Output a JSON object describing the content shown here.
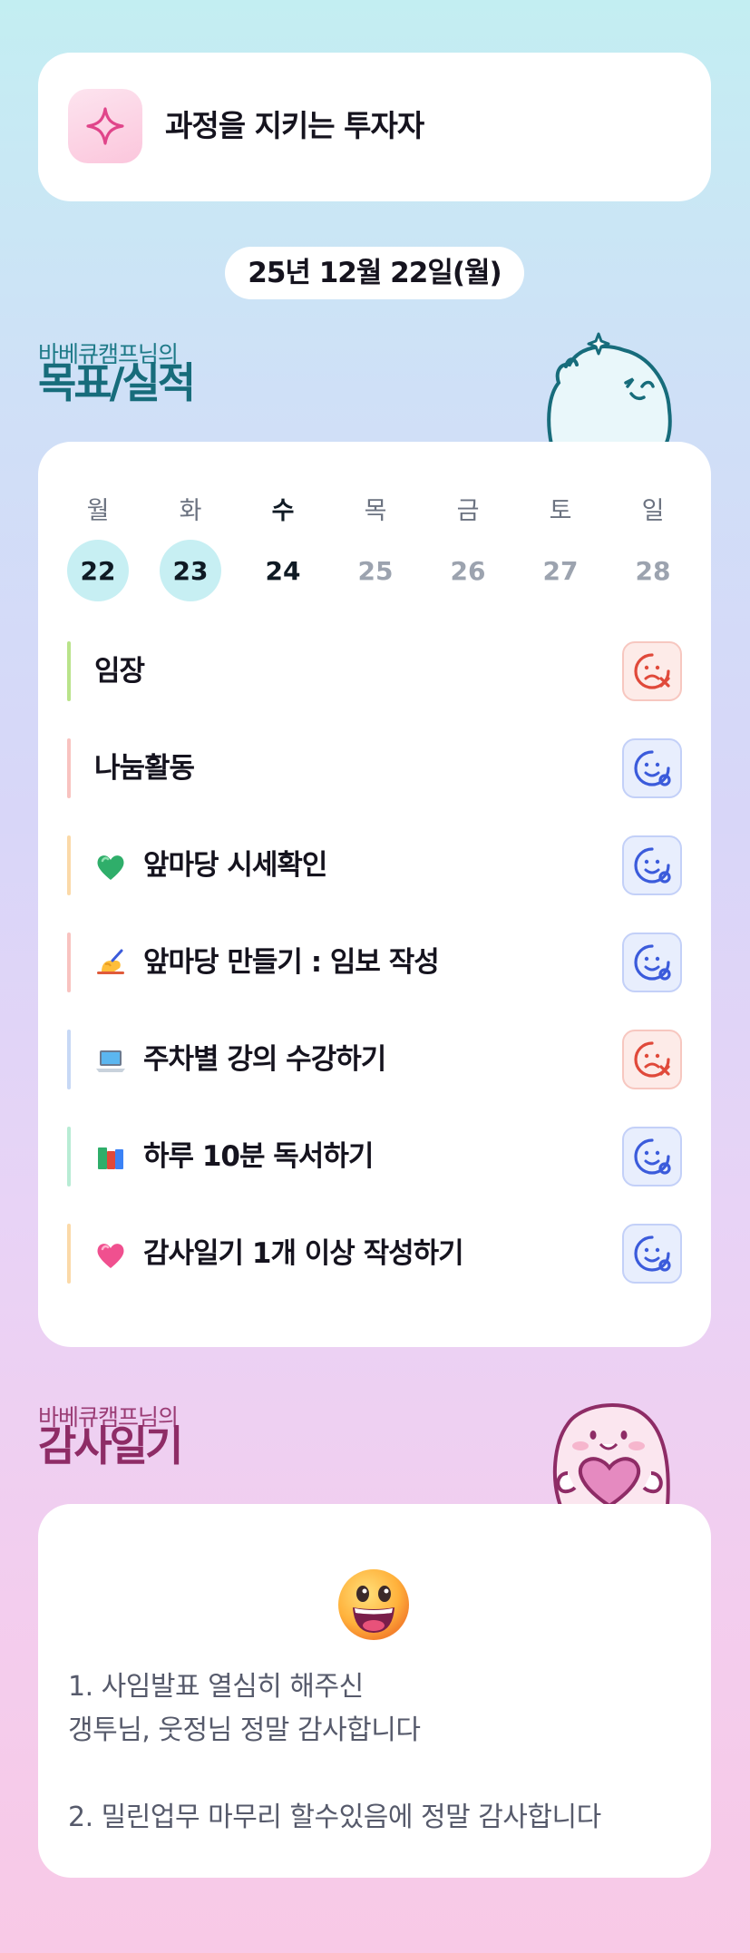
{
  "mission": {
    "title": "과정을 지키는 투자자",
    "icon": "sparkle-icon"
  },
  "date": "25년 12월 22일(월)",
  "goals_section": {
    "owner": "바베큐캠프님의",
    "title": "목표/실적"
  },
  "week": [
    {
      "day": "월",
      "date": "22",
      "state": "done"
    },
    {
      "day": "화",
      "date": "23",
      "state": "done"
    },
    {
      "day": "수",
      "date": "24",
      "state": "today"
    },
    {
      "day": "목",
      "date": "25",
      "state": "future"
    },
    {
      "day": "금",
      "date": "26",
      "state": "future"
    },
    {
      "day": "토",
      "date": "27",
      "state": "future"
    },
    {
      "day": "일",
      "date": "28",
      "state": "future"
    }
  ],
  "goals": [
    {
      "label": "임장",
      "emoji": "",
      "status": "fail",
      "bar_color": "#b9e38a"
    },
    {
      "label": "나눔활동",
      "emoji": "",
      "status": "success",
      "bar_color": "#f8c3c0"
    },
    {
      "label": "앞마당 시세확인",
      "emoji": "green-heart-icon",
      "status": "success",
      "bar_color": "#fbd9a8"
    },
    {
      "label": "앞마당 만들기 : 임보 작성",
      "emoji": "writing-hand-icon",
      "status": "success",
      "bar_color": "#f8c3c0"
    },
    {
      "label": "주차별 강의 수강하기",
      "emoji": "laptop-icon",
      "status": "fail",
      "bar_color": "#c7d8f5"
    },
    {
      "label": "하루 10분 독서하기",
      "emoji": "books-icon",
      "status": "success",
      "bar_color": "#b8ecd4"
    },
    {
      "label": "감사일기 1개 이상 작성하기",
      "emoji": "pink-heart-icon",
      "status": "success",
      "bar_color": "#fbd9a8"
    }
  ],
  "diary_section": {
    "owner": "바베큐캠프님의",
    "title": "감사일기"
  },
  "diary": {
    "emoji": "grinning-face-icon",
    "lines": [
      "1. 사임발표 열심히 해주신",
      "갱투님, 웃정님 정말 감사합니다",
      "",
      "2. 밀린업무 마무리 할수있음에 정말 감사합니다"
    ]
  },
  "colors": {
    "accent_teal": "#176c7b",
    "accent_pink": "#8e2c66",
    "fail_red": "#e0493a",
    "success_blue": "#3b5bdb"
  }
}
